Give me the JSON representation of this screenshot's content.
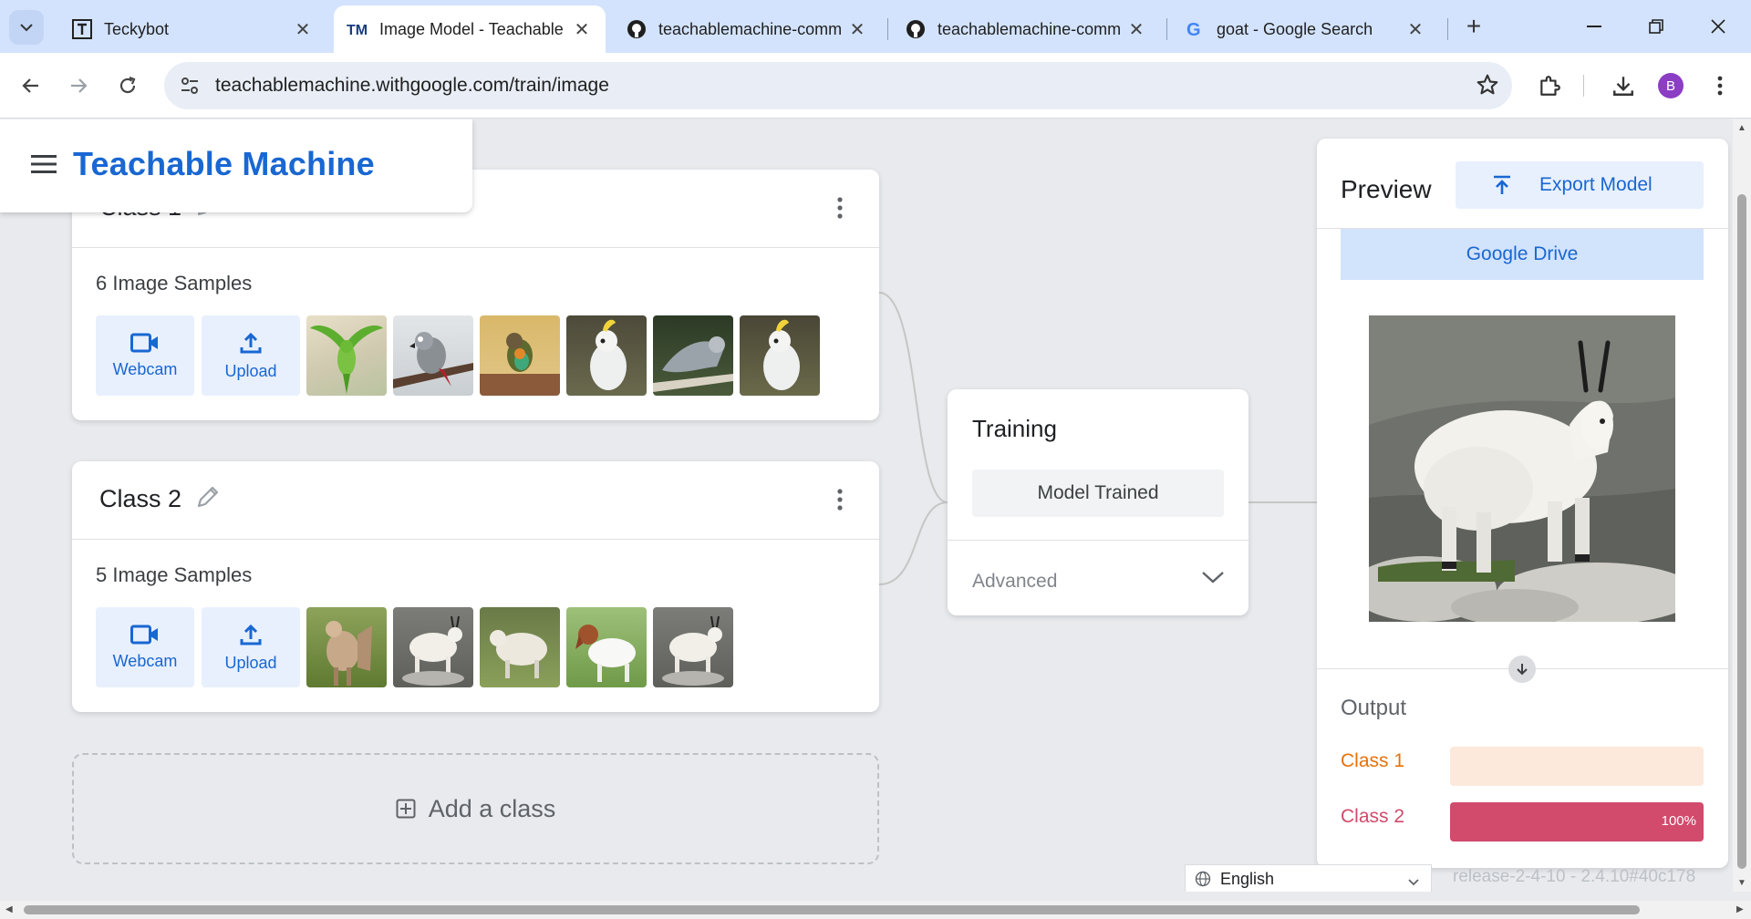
{
  "browser": {
    "tabs": [
      {
        "title": "Teckybot",
        "favicon": "teckybot-icon",
        "active": false
      },
      {
        "title": "Image Model - Teachable",
        "favicon": "teachable-machine-icon",
        "active": true
      },
      {
        "title": "teachablemachine-comm",
        "favicon": "github-icon",
        "active": false
      },
      {
        "title": "teachablemachine-comm",
        "favicon": "github-icon",
        "active": false
      },
      {
        "title": "goat - Google Search",
        "favicon": "google-icon",
        "active": false
      }
    ],
    "url": "teachablemachine.withgoogle.com/train/image",
    "profile_initial": "B"
  },
  "app": {
    "brand": "Teachable Machine"
  },
  "classes": [
    {
      "name": "Class 1",
      "samples_label": "6 Image Samples",
      "webcam_label": "Webcam",
      "upload_label": "Upload",
      "thumbnails": [
        "green-parrot-flying",
        "grey-parrot-on-branch",
        "orange-bellied-parrot",
        "cockatoo",
        "grey-parrot-on-wood",
        "cockatoo"
      ]
    },
    {
      "name": "Class 2",
      "samples_label": "5 Image Samples",
      "webcam_label": "Webcam",
      "upload_label": "Upload",
      "thumbnails": [
        "goat-kid",
        "mountain-goat",
        "white-goat-on-grass",
        "boer-goat",
        "mountain-goat"
      ]
    }
  ],
  "add_class_label": "Add a class",
  "training": {
    "title": "Training",
    "status_button": "Model Trained",
    "advanced_label": "Advanced"
  },
  "preview": {
    "title": "Preview",
    "export_label": "Export Model",
    "drive_label": "Google Drive",
    "image": "mountain-goat",
    "output_label": "Output",
    "outputs": [
      {
        "label": "Class 1",
        "value": 0,
        "value_text": "",
        "color": "#e8710a",
        "track": "#fde9dc"
      },
      {
        "label": "Class 2",
        "value": 1,
        "value_text": "100%",
        "color": "#d24a6c",
        "track": "#f7d5de"
      }
    ]
  },
  "footer": {
    "language": "English",
    "release": "release-2-4-10 - 2.4.10#40c178"
  }
}
